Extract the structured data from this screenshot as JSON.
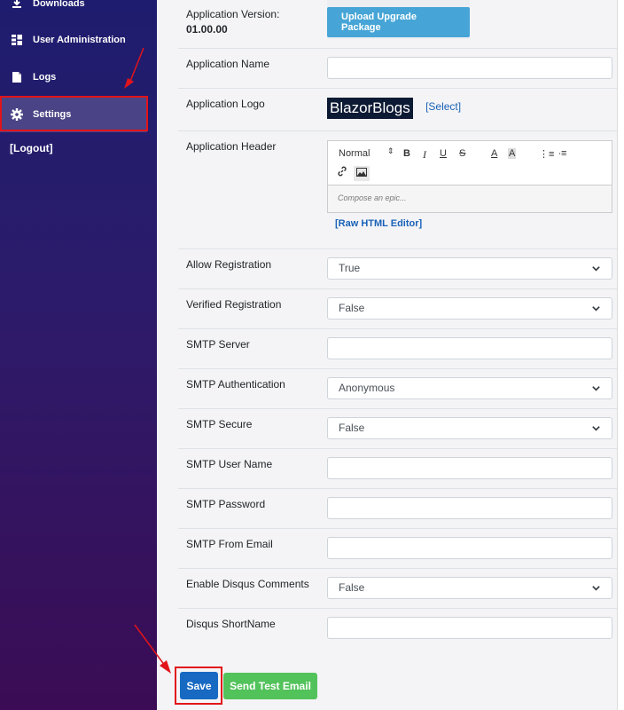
{
  "sidebar": {
    "items": [
      {
        "label": "Downloads",
        "icon": "download-icon"
      },
      {
        "label": "User Administration",
        "icon": "user-admin-icon"
      },
      {
        "label": "Logs",
        "icon": "logs-icon"
      },
      {
        "label": "Settings",
        "icon": "gear-icon"
      }
    ],
    "logout": "[Logout]",
    "active": "Settings"
  },
  "settings": {
    "app_version_label": "Application Version:",
    "app_version_value": "01.00.00",
    "upgrade_button": "Upload Upgrade Package",
    "app_name_label": "Application Name",
    "app_name_value": "",
    "app_logo_label": "Application Logo",
    "logo_text": "BlazorBlogs",
    "select_link": "[Select]",
    "app_header_label": "Application Header",
    "editor_format": "Normal",
    "editor_placeholder": "Compose an epic...",
    "raw_html_link": "[Raw HTML Editor]",
    "allow_registration_label": "Allow Registration",
    "allow_registration_value": "True",
    "verified_registration_label": "Verified Registration",
    "verified_registration_value": "False",
    "smtp_server_label": "SMTP Server",
    "smtp_server_value": "",
    "smtp_auth_label": "SMTP Authentication",
    "smtp_auth_value": "Anonymous",
    "smtp_secure_label": "SMTP Secure",
    "smtp_secure_value": "False",
    "smtp_user_label": "SMTP User Name",
    "smtp_user_value": "",
    "smtp_password_label": "SMTP Password",
    "smtp_password_value": "",
    "smtp_from_label": "SMTP From Email",
    "smtp_from_value": "",
    "disqus_enable_label": "Enable Disqus Comments",
    "disqus_enable_value": "False",
    "disqus_shortname_label": "Disqus ShortName",
    "disqus_shortname_value": ""
  },
  "actions": {
    "save": "Save",
    "send_test_email": "Send Test Email"
  },
  "colors": {
    "annotation": "#e1141a",
    "save": "#1769c2",
    "test_email": "#52c25a",
    "upgrade": "#46a5d6"
  }
}
